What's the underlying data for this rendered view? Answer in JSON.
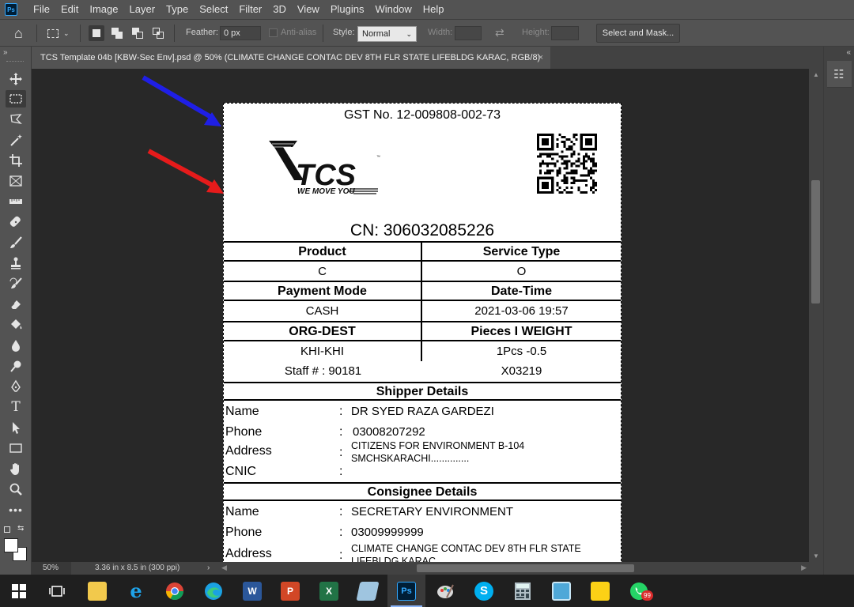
{
  "app": {
    "logo_text": "Ps",
    "menu": [
      "File",
      "Edit",
      "Image",
      "Layer",
      "Type",
      "Select",
      "Filter",
      "3D",
      "View",
      "Plugins",
      "Window",
      "Help"
    ]
  },
  "options": {
    "feather_label": "Feather:",
    "feather_value": "0 px",
    "antialias_label": "Anti-alias",
    "style_label": "Style:",
    "style_value": "Normal",
    "width_label": "Width:",
    "height_label": "Height:",
    "select_mask_label": "Select and Mask..."
  },
  "toolbar": {
    "tools": [
      "move-tool",
      "rectangular-marquee-tool",
      "lasso-tool",
      "magic-wand-tool",
      "crop-tool",
      "frame-tool",
      "ruler-tool",
      "healing-brush-tool",
      "brush-tool",
      "clone-stamp-tool",
      "history-brush-tool",
      "eraser-tool",
      "paint-bucket-tool",
      "blur-tool",
      "dodge-tool",
      "pen-tool",
      "type-tool",
      "path-selection-tool",
      "rectangle-tool",
      "hand-tool",
      "zoom-tool",
      "edit-toolbar"
    ],
    "active_tool": "rectangular-marquee-tool",
    "foreground_color": "#ffffff",
    "background_color": "#ffffff"
  },
  "document": {
    "tab_title": "TCS Template 04b [KBW-Sec Env].psd @ 50% (CLIMATE CHANGE CONTAC DEV 8TH FLR STATE LIFEBLDG KARAC, RGB/8)",
    "close_glyph": "×"
  },
  "receipt": {
    "gst": "GST No. 12-009808-002-73",
    "logo_main": "TCS",
    "logo_tagline": "WE MOVE YOU",
    "cn": "CN: 306032085226",
    "product_header": "Product",
    "service_header": "Service Type",
    "product_value": "C",
    "service_value": "O",
    "payment_header": "Payment Mode",
    "datetime_header": "Date-Time",
    "payment_value": "CASH",
    "datetime_value": "2021-03-06 19:57",
    "orgdest_header": "ORG-DEST",
    "pieces_header": "Pieces I WEIGHT",
    "orgdest_value": "KHI-KHI",
    "pieces_value": "1Pcs -0.5",
    "staff_value": "Staff # : 90181",
    "code_value": "X03219",
    "shipper_header": "Shipper Details",
    "shipper": {
      "name_label": "Name",
      "name_value": "DR SYED RAZA GARDEZI",
      "phone_label": "Phone",
      "phone_value": "03008207292",
      "address_label": "Address",
      "address_line1": "CITIZENS FOR ENVIRONMENT B-104",
      "address_line2": "SMCHSKARACHI..............",
      "cnic_label": "CNIC"
    },
    "consignee_header": "Consignee Details",
    "consignee": {
      "name_label": "Name",
      "name_value": "SECRETARY ENVIRONMENT",
      "phone_label": "Phone",
      "phone_value": "03009999999",
      "address_label": "Address",
      "address_line1": "CLIMATE CHANGE CONTAC DEV 8TH FLR STATE",
      "address_line2": "LIFEBLDG KARAC"
    },
    "colon": ":"
  },
  "annotations": {
    "blue_arrow_color": "#1f1fe6",
    "red_arrow_color": "#e61b1b"
  },
  "status": {
    "zoom": "50%",
    "doc_info": "3.36 in x 8.5 in (300 ppi)",
    "arrow": "›"
  },
  "taskbar": {
    "apps": [
      "file-explorer",
      "internet-explorer",
      "chrome",
      "edge",
      "word",
      "powerpoint",
      "excel",
      "snipping-tool",
      "photoshop",
      "paint",
      "skype",
      "calculator",
      "wordpad",
      "sticky-notes",
      "whatsapp"
    ],
    "whatsapp_badge": "99",
    "labels": {
      "word": "W",
      "powerpoint": "P",
      "excel": "X",
      "photoshop": "Ps",
      "skype": "S"
    }
  }
}
